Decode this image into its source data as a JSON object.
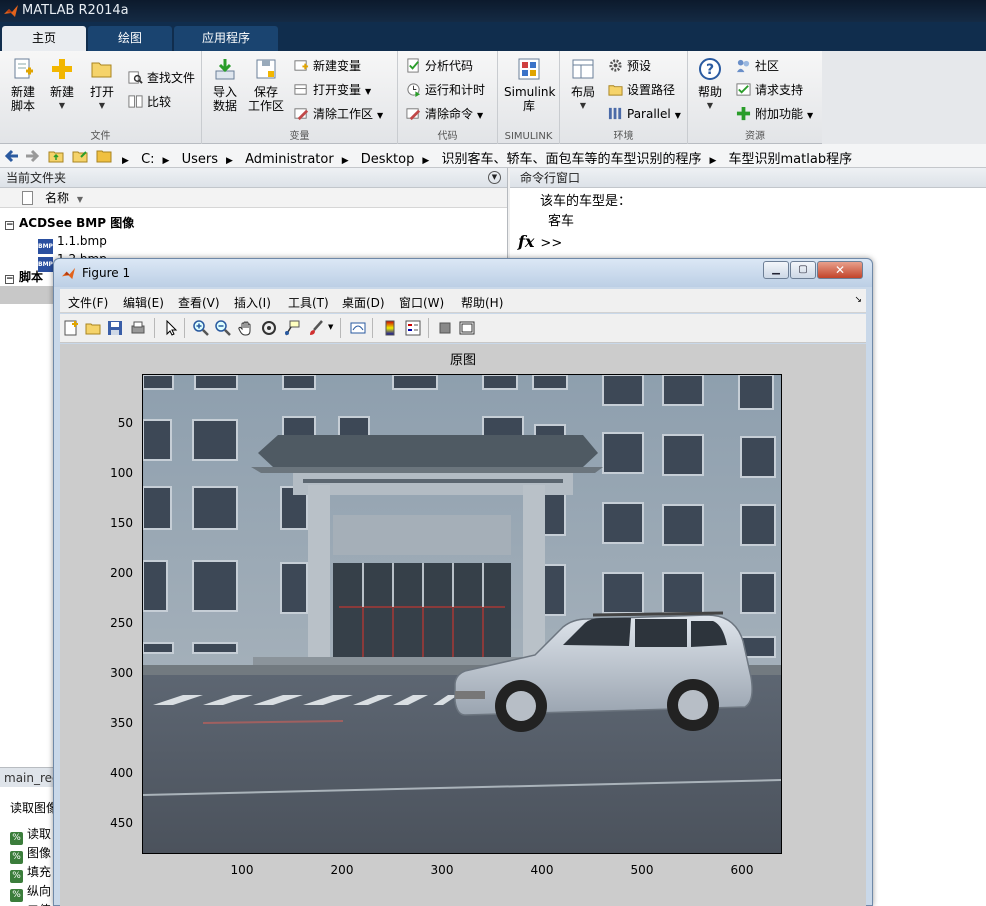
{
  "app": {
    "title": "MATLAB R2014a"
  },
  "tabs": [
    {
      "label": "主页",
      "active": true
    },
    {
      "label": "绘图",
      "active": false
    },
    {
      "label": "应用程序",
      "active": false
    }
  ],
  "ribbon": {
    "groups": {
      "file": "文件",
      "variable": "变量",
      "code": "代码",
      "simulink": "SIMULINK",
      "environment": "环境",
      "resources": "资源"
    },
    "new_script": "新建\n脚本",
    "new_script_l1": "新建",
    "new_script_l2": "脚本",
    "new": "新建",
    "open": "打开",
    "find_files": "查找文件",
    "compare": "比较",
    "import_l1": "导入",
    "import_l2": "数据",
    "save_l1": "保存",
    "save_l2": "工作区",
    "new_variable": "新建变量",
    "open_variable": "打开变量",
    "clear_workspace": "清除工作区",
    "analyze_code": "分析代码",
    "run_and_time": "运行和计时",
    "clear_commands": "清除命令",
    "simulink_l1": "Simulink",
    "simulink_l2": "库",
    "layout": "布局",
    "preferences": "预设",
    "set_path": "设置路径",
    "parallel": "Parallel",
    "help": "帮助",
    "community": "社区",
    "request_support": "请求支持",
    "addons": "附加功能"
  },
  "address": {
    "crumbs": [
      "C:",
      "Users",
      "Administrator",
      "Desktop",
      "识别客车、轿车、面包车等的车型识别的程序",
      "车型识别matlab程序"
    ]
  },
  "current_folder": {
    "header": "当前文件夹",
    "column_name": "名称",
    "groups": [
      {
        "label": "ACDSee BMP 图像",
        "files": [
          "1.1.bmp",
          "1.2.bmp"
        ]
      },
      {
        "label": "脚本"
      }
    ]
  },
  "editor_tab": "main_rec",
  "details": {
    "header": "读取图像",
    "lines": [
      "读取",
      "图像",
      "填充",
      "纵向",
      "二值"
    ]
  },
  "command_window": {
    "header": "命令行窗口",
    "output": [
      "该车的车型是：",
      "客车"
    ],
    "prompt": ">>"
  },
  "figure": {
    "title": "Figure 1",
    "menu": [
      "文件(F)",
      "编辑(E)",
      "查看(V)",
      "插入(I)",
      "工具(T)",
      "桌面(D)",
      "窗口(W)",
      "帮助(H)"
    ],
    "axes_title": "原图",
    "yticks": [
      "50",
      "100",
      "150",
      "200",
      "250",
      "300",
      "350",
      "400",
      "450"
    ],
    "xticks": [
      "100",
      "200",
      "300",
      "400",
      "500",
      "600"
    ]
  },
  "colors": {
    "title_bg": "#0c1a2c",
    "tab_bg": "#102d4d",
    "canvas_bg": "#cccccc"
  }
}
